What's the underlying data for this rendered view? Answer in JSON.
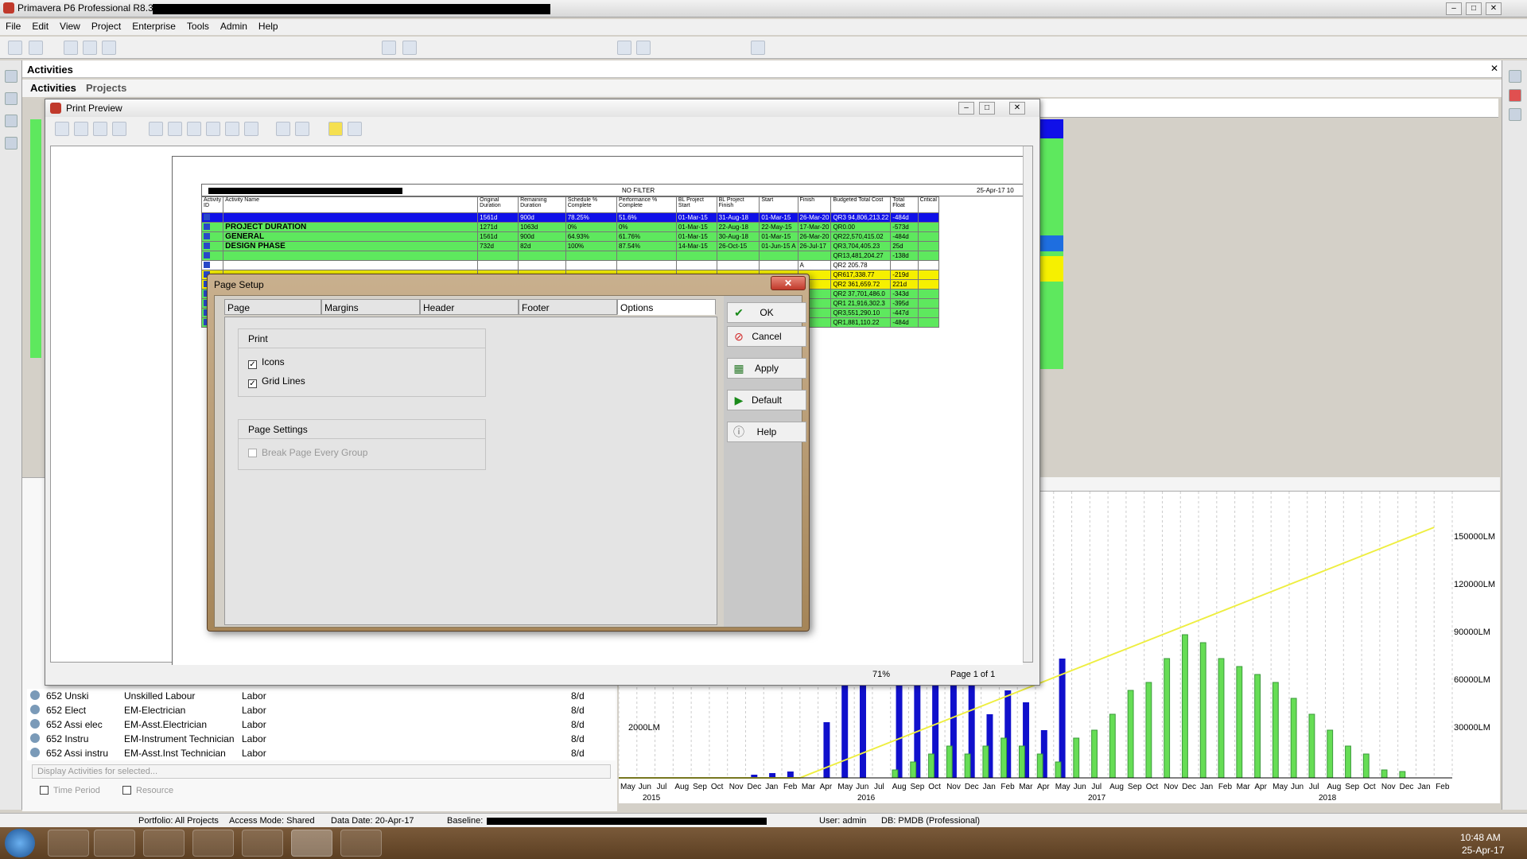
{
  "window": {
    "title": "Primavera P6 Professional R8.3 :"
  },
  "menu": [
    "File",
    "Edit",
    "View",
    "Project",
    "Enterprise",
    "Tools",
    "Admin",
    "Help"
  ],
  "main": {
    "header": "Activities",
    "tabs": [
      "Activities",
      "Projects"
    ]
  },
  "preview": {
    "title": "Print Preview",
    "zoom": "71%",
    "page": "Page 1 of 1",
    "report": {
      "filter": "NO FILTER",
      "date": "25-Apr-17 10",
      "columns": [
        "Activity ID",
        "Activity Name",
        "Original Duration",
        "Remaining Duration",
        "Schedule % Complete",
        "Performance % Complete",
        "BL Project Start",
        "BL Project Finish",
        "Start",
        "Finish",
        "Budgeted Total Cost",
        "Total Float",
        "Critical"
      ],
      "rows": [
        {
          "name": "",
          "od": "1561d",
          "rd": "900d",
          "sc": "78.25%",
          "pc": "51.6%",
          "bs": "01-Mar-15",
          "bf": "31-Aug-18",
          "st": "01-Mar-15",
          "fi": "26-Mar-20",
          "cost": "QR3 94,806,213.22",
          "tf": "-484d",
          "kind": "blue"
        },
        {
          "name": "PROJECT DURATION",
          "od": "1271d",
          "rd": "1063d",
          "sc": "0%",
          "pc": "0%",
          "bs": "01-Mar-15",
          "bf": "22-Aug-18",
          "st": "22-May-15",
          "fi": "17-Mar-20",
          "cost": "QR0.00",
          "tf": "-573d",
          "kind": "green"
        },
        {
          "name": "GENERAL",
          "od": "1561d",
          "rd": "900d",
          "sc": "64.93%",
          "pc": "61.76%",
          "bs": "01-Mar-15",
          "bf": "30-Aug-18",
          "st": "01-Mar-15",
          "fi": "26-Mar-20",
          "cost": "QR22,570,415.02",
          "tf": "-484d",
          "kind": "green"
        },
        {
          "name": "DESIGN PHASE",
          "od": "732d",
          "rd": "82d",
          "sc": "100%",
          "pc": "87.54%",
          "bs": "14-Mar-15",
          "bf": "26-Oct-15",
          "st": "01-Jun-15 A",
          "fi": "26-Jul-17",
          "cost": "QR3,704,405.23",
          "tf": "25d",
          "kind": "green"
        },
        {
          "name": "",
          "od": "",
          "rd": "",
          "sc": "",
          "pc": "",
          "bs": "",
          "bf": "",
          "st": "",
          "fi": "",
          "cost": "QR13,481,204.27",
          "tf": "-138d",
          "kind": "green"
        },
        {
          "name": "",
          "od": "",
          "rd": "",
          "sc": "",
          "pc": "",
          "bs": "",
          "bf": "",
          "st": "",
          "fi": "A",
          "cost": "QR2 205.78",
          "tf": "",
          "kind": "white"
        },
        {
          "name": "",
          "od": "",
          "rd": "",
          "sc": "",
          "pc": "",
          "bs": "",
          "bf": "",
          "st": "",
          "fi": "",
          "cost": "QR617,338.77",
          "tf": "-219d",
          "kind": "yellow"
        },
        {
          "name": "",
          "od": "",
          "rd": "",
          "sc": "",
          "pc": "",
          "bs": "",
          "bf": "",
          "st": "",
          "fi": "",
          "cost": "QR2 361,659.72",
          "tf": "221d",
          "kind": "yellow"
        },
        {
          "name": "",
          "od": "",
          "rd": "",
          "sc": "",
          "pc": "",
          "bs": "",
          "bf": "",
          "st": "",
          "fi": "",
          "cost": "QR2 37,701,486.0",
          "tf": "-343d",
          "kind": "green"
        },
        {
          "name": "",
          "od": "",
          "rd": "",
          "sc": "",
          "pc": "",
          "bs": "",
          "bf": "",
          "st": "",
          "fi": "",
          "cost": "QR1 21,916,302.3",
          "tf": "-395d",
          "kind": "green"
        },
        {
          "name": "",
          "od": "",
          "rd": "",
          "sc": "",
          "pc": "",
          "bs": "",
          "bf": "",
          "st": "",
          "fi": "",
          "cost": "QR3,551,290.10",
          "tf": "-447d",
          "kind": "green"
        },
        {
          "name": "",
          "od": "",
          "rd": "",
          "sc": "",
          "pc": "",
          "bs": "",
          "bf": "",
          "st": "",
          "fi": "",
          "cost": "QR1,881,110.22",
          "tf": "-484d",
          "kind": "green"
        }
      ]
    }
  },
  "pagesetup": {
    "title": "Page Setup",
    "tabs": [
      "Page",
      "Margins",
      "Header",
      "Footer",
      "Options"
    ],
    "print_group": "Print",
    "icons_label": "Icons",
    "grid_label": "Grid Lines",
    "settings_group": "Page Settings",
    "break_label": "Break Page Every Group",
    "buttons": {
      "ok": "OK",
      "cancel": "Cancel",
      "apply": "Apply",
      "default": "Default",
      "help": "Help"
    }
  },
  "resources": {
    "rows": [
      {
        "id": "652 Unski",
        "name": "Unskilled Labour",
        "type": "Labor",
        "units": "8/d"
      },
      {
        "id": "652 Elect",
        "name": "EM-Electrician",
        "type": "Labor",
        "units": "8/d"
      },
      {
        "id": "652 Assi elec",
        "name": "EM-Asst.Electrician",
        "type": "Labor",
        "units": "8/d"
      },
      {
        "id": "652 Instru",
        "name": "EM-Instrument Technician",
        "type": "Labor",
        "units": "8/d"
      },
      {
        "id": "652 Assi instru",
        "name": "EM-Asst.Inst Technician",
        "type": "Labor",
        "units": "8/d"
      }
    ],
    "display_placeholder": "Display Activities for selected...",
    "time_period": "Time Period",
    "resource": "Resource"
  },
  "chart_data": {
    "type": "bar",
    "right_axis": [
      "150000LM",
      "120000LM",
      "90000LM",
      "60000LM",
      "30000LM"
    ],
    "left_axis": [
      "2000LM"
    ],
    "months": [
      "May",
      "Jun",
      "Jul",
      "Aug",
      "Sep",
      "Oct",
      "Nov",
      "Dec",
      "Jan",
      "Feb",
      "Mar",
      "Apr",
      "May",
      "Jun",
      "Jul",
      "Aug",
      "Sep",
      "Oct",
      "Nov",
      "Dec",
      "Jan",
      "Feb",
      "Mar",
      "Apr",
      "May",
      "Jun",
      "Jul",
      "Aug",
      "Sep",
      "Oct",
      "Nov",
      "Dec",
      "Jan",
      "Feb",
      "Mar",
      "Apr",
      "May",
      "Jun",
      "Jul",
      "Aug",
      "Sep",
      "Oct",
      "Nov",
      "Dec",
      "Jan",
      "Feb"
    ],
    "years": [
      "2015",
      "2016",
      "2017",
      "2018"
    ],
    "colors": {
      "actual": "#1010cc",
      "remaining": "#66dd55",
      "cum": "#eeee40"
    }
  },
  "status": {
    "portfolio": "Portfolio: All Projects",
    "access": "Access Mode: Shared",
    "datadate": "Data Date: 20-Apr-17",
    "baseline": "Baseline:",
    "user": "User: admin",
    "db": "DB: PMDB (Professional)"
  },
  "clock": {
    "time": "10:48 AM",
    "date": "25-Apr-17"
  }
}
